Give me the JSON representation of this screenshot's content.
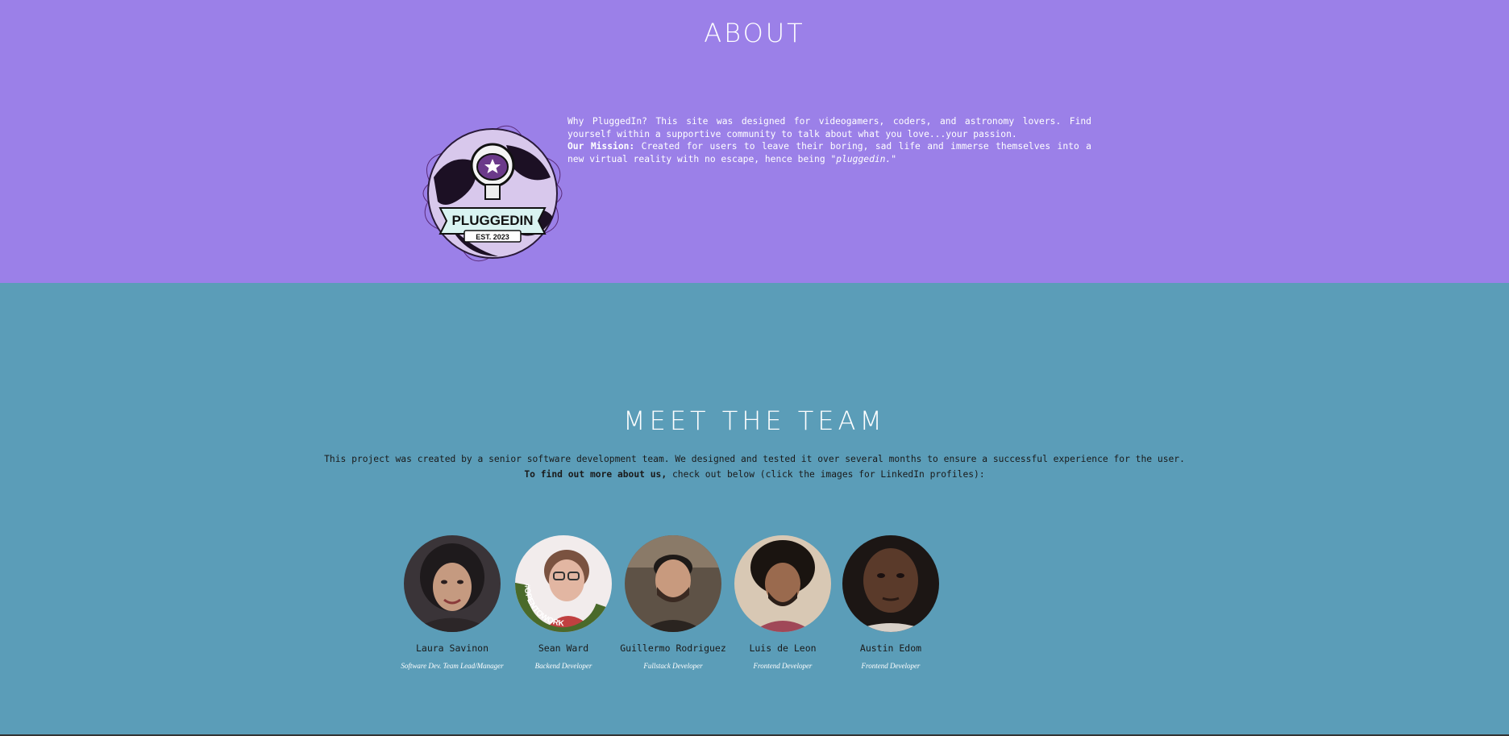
{
  "about": {
    "title": "ABOUT",
    "logo": {
      "icon": "pluggedin-astronaut-globe-logo",
      "text": "PLUGGEDIN",
      "subtext": "EST. 2023"
    },
    "paragraph1": "Why PluggedIn? This site was designed for videogamers, coders, and astronomy lovers. Find yourself within a supportive community to talk about what you love...your passion.",
    "mission_label": "Our Mission:",
    "mission_text": " Created for users to leave their boring, sad life and immerse themselves into a new virtual reality with no escape, hence being \"",
    "mission_em": "pluggedin.",
    "mission_end": "\""
  },
  "team": {
    "title": "MEET THE TEAM",
    "intro_line1": "This project was created by a senior software development team. We designed and tested it over several months to ensure a successful experience for the user.",
    "intro_bold": "To find out more about us,",
    "intro_line2_rest": " check out below (click the images for LinkedIn profiles):",
    "members": [
      {
        "name": "Laura Savinon",
        "role": "Software Dev. Team Lead/Manager"
      },
      {
        "name": "Sean Ward",
        "role": "Backend Developer",
        "badge": "#OPENTOWORK"
      },
      {
        "name": "Guillermo Rodriguez",
        "role": "Fullstack Developer"
      },
      {
        "name": "Luis de Leon",
        "role": "Frontend Developer"
      },
      {
        "name": "Austin Edom",
        "role": "Frontend Developer"
      }
    ]
  },
  "colors": {
    "about_bg": "#9b80e8",
    "team_bg": "#5b9db8",
    "logo_accent": "#7a3fa0"
  }
}
